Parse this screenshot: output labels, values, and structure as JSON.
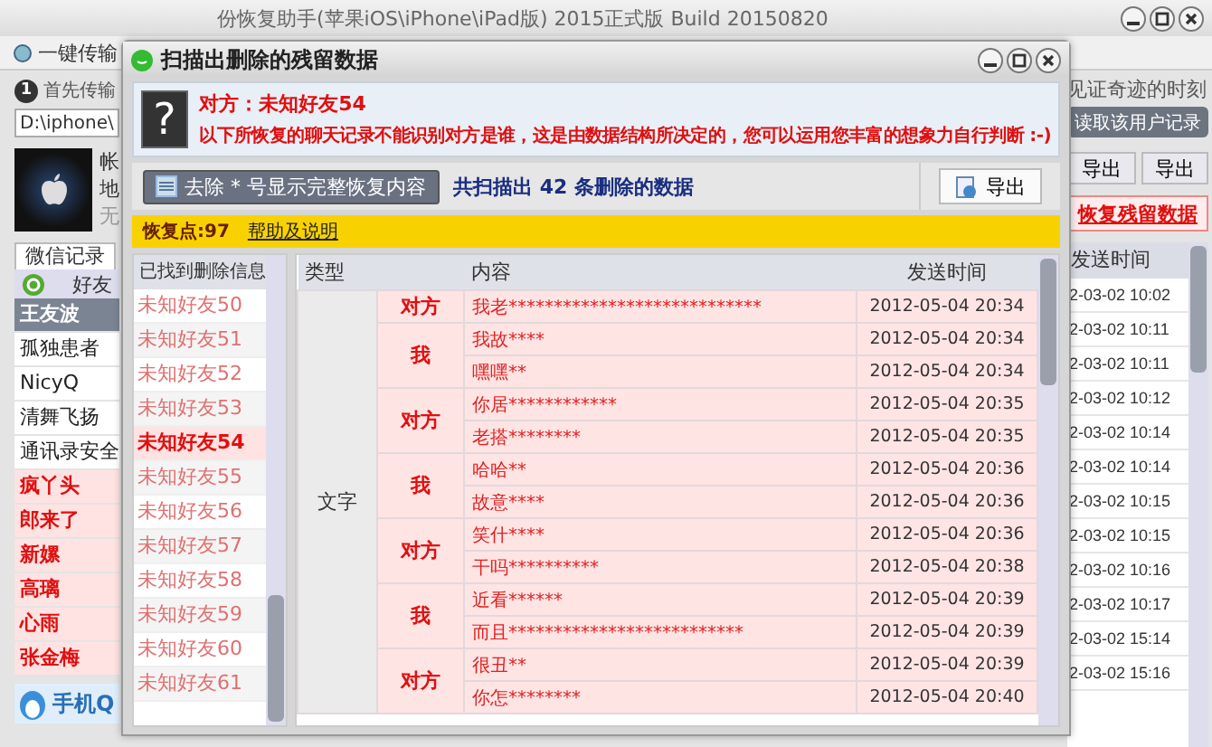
{
  "main_window": {
    "title": "份恢复助手(苹果iOS\\iPhone\\iPad版) 2015正式版 Build 20150820",
    "toolbar": {
      "button": "一键传输"
    },
    "step": {
      "number": "1",
      "text": "首先传输"
    },
    "path_field": {
      "value": "D:\\iphone\\"
    },
    "device": {
      "lines": [
        "帐",
        "地",
        "无"
      ]
    },
    "tab": "微信记录",
    "friends_header": "好友",
    "contacts": [
      {
        "name": "王友波",
        "selected": true,
        "deleted": false
      },
      {
        "name": "孤独患者",
        "selected": false,
        "deleted": false
      },
      {
        "name": "NicyQ",
        "selected": false,
        "deleted": false
      },
      {
        "name": "清舞飞扬",
        "selected": false,
        "deleted": false
      },
      {
        "name": "通讯录安全",
        "selected": false,
        "deleted": false
      },
      {
        "name": "疯丫头",
        "selected": false,
        "deleted": true
      },
      {
        "name": "郎来了",
        "selected": false,
        "deleted": true
      },
      {
        "name": "新嫘",
        "selected": false,
        "deleted": true
      },
      {
        "name": "高璃",
        "selected": false,
        "deleted": true
      },
      {
        "name": "心雨",
        "selected": false,
        "deleted": true
      },
      {
        "name": "张金梅",
        "selected": false,
        "deleted": true
      }
    ],
    "qq_logo": "手机Q",
    "right": {
      "caption": "见证奇迹的时刻",
      "read_button": "读取该用户记录",
      "export_buttons": [
        "导出",
        "导出"
      ],
      "recover_link": "恢复残留数据",
      "time_header": "发送时间",
      "times": [
        "2-03-02 10:02",
        "2-03-02 10:11",
        "2-03-02 10:11",
        "2-03-02 10:12",
        "2-03-02 10:14",
        "2-03-02 10:14",
        "2-03-02 10:15",
        "2-03-02 10:15",
        "2-03-02 10:16",
        "2-03-02 10:17",
        "2-03-02 15:14",
        "2-03-02 15:16"
      ]
    }
  },
  "dialog": {
    "title": "扫描出删除的残留数据",
    "header": {
      "icon_char": "?",
      "peer": "对方：未知好友54",
      "notice": "以下所恢复的聊天记录不能识别对方是谁，这是由数据结构所决定的，您可以运用您丰富的想象力自行判断 :-)"
    },
    "strip_button": "去除 * 号显示完整恢复内容",
    "summary": "共扫描出 42 条删除的数据",
    "export_button": "导出",
    "restore_point": "恢复点:97",
    "help_link": "帮助及说明",
    "list_header": "已找到删除信息",
    "friends": [
      {
        "name": "未知好友50",
        "selected": false
      },
      {
        "name": "未知好友51",
        "selected": false
      },
      {
        "name": "未知好友52",
        "selected": false
      },
      {
        "name": "未知好友53",
        "selected": false
      },
      {
        "name": "未知好友54",
        "selected": true
      },
      {
        "name": "未知好友55",
        "selected": false
      },
      {
        "name": "未知好友56",
        "selected": false
      },
      {
        "name": "未知好友57",
        "selected": false
      },
      {
        "name": "未知好友58",
        "selected": false
      },
      {
        "name": "未知好友59",
        "selected": false
      },
      {
        "name": "未知好友60",
        "selected": false
      },
      {
        "name": "未知好友61",
        "selected": false
      }
    ],
    "table": {
      "columns": [
        "类型",
        "内容",
        "发送时间"
      ],
      "type": "文字",
      "groups": [
        {
          "sender": "对方",
          "messages": [
            {
              "text": "我老****************************",
              "time": "2012-05-04 20:34"
            }
          ]
        },
        {
          "sender": "我",
          "messages": [
            {
              "text": "我故****",
              "time": "2012-05-04 20:34"
            },
            {
              "text": "嘿嘿**",
              "time": "2012-05-04 20:34"
            }
          ]
        },
        {
          "sender": "对方",
          "messages": [
            {
              "text": "你居************",
              "time": "2012-05-04 20:35"
            },
            {
              "text": "老搭********",
              "time": "2012-05-04 20:35"
            }
          ]
        },
        {
          "sender": "我",
          "messages": [
            {
              "text": "哈哈**",
              "time": "2012-05-04 20:36"
            },
            {
              "text": "故意****",
              "time": "2012-05-04 20:36"
            }
          ]
        },
        {
          "sender": "对方",
          "messages": [
            {
              "text": "笑什****",
              "time": "2012-05-04 20:36"
            },
            {
              "text": "干吗**********",
              "time": "2012-05-04 20:38"
            }
          ]
        },
        {
          "sender": "我",
          "messages": [
            {
              "text": "近看******",
              "time": "2012-05-04 20:39"
            },
            {
              "text": "而且**************************",
              "time": "2012-05-04 20:39"
            }
          ]
        },
        {
          "sender": "对方",
          "messages": [
            {
              "text": "很丑**",
              "time": "2012-05-04 20:39"
            },
            {
              "text": "你怎********",
              "time": "2012-05-04 20:40"
            }
          ]
        }
      ]
    }
  }
}
